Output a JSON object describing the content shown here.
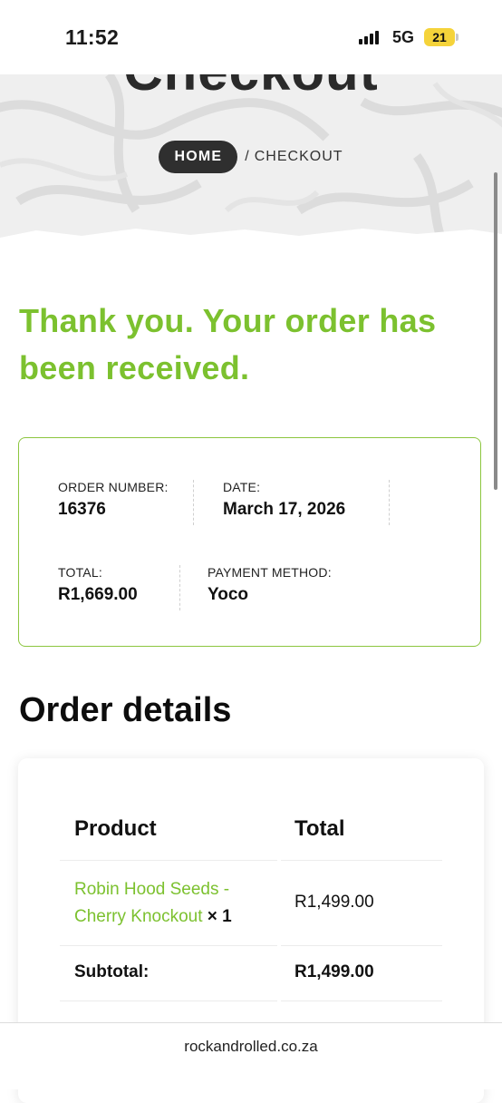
{
  "status_bar": {
    "time": "11:52",
    "network": "5G",
    "battery": "21"
  },
  "hero": {
    "title": "Checkout",
    "breadcrumb": {
      "home": "HOME",
      "separator": "/",
      "current": "CHECKOUT"
    }
  },
  "confirmation": {
    "message": "Thank you. Your order has been received."
  },
  "overview": {
    "order_number_label": "ORDER NUMBER:",
    "order_number": "16376",
    "date_label": "DATE:",
    "date": "March 17, 2026",
    "total_label": "TOTAL:",
    "total": "R1,669.00",
    "payment_label": "PAYMENT METHOD:",
    "payment": "Yoco"
  },
  "order_details": {
    "heading": "Order details",
    "col_product": "Product",
    "col_total": "Total",
    "items": [
      {
        "name": "Robin Hood Seeds - Cherry Knockout",
        "qty": "× 1",
        "total": "R1,499.00"
      }
    ],
    "subtotal_label": "Subtotal:",
    "subtotal": "R1,499.00"
  },
  "browser": {
    "url": "rockandrolled.co.za"
  },
  "colors": {
    "accent": "#7cc12f",
    "border_accent": "#8cc63f",
    "battery": "#f5d33a"
  }
}
